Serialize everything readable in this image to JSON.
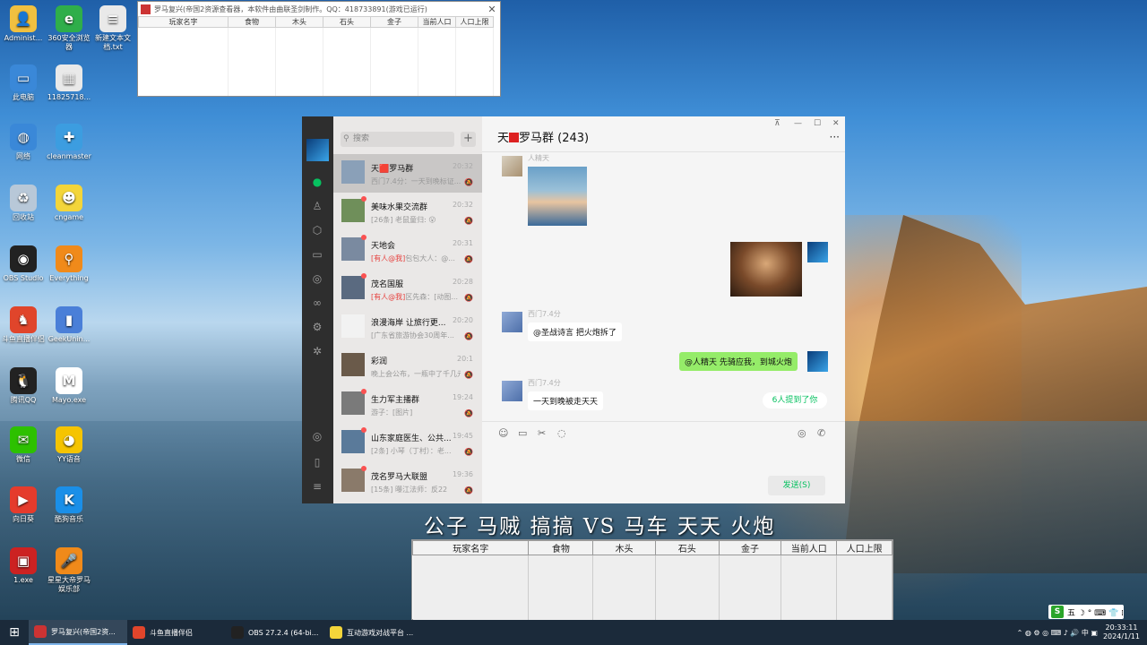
{
  "desktop_icons": [
    {
      "label": "Administ...",
      "color": "#f0c040",
      "glyph": "👤"
    },
    {
      "label": "360安全浏览器",
      "color": "#2fae4a",
      "glyph": "e"
    },
    {
      "label": "新建文本文档.txt",
      "color": "#e9e9e9",
      "glyph": "≡"
    },
    {
      "label": "此电脑",
      "color": "#3a88d8",
      "glyph": "▭"
    },
    {
      "label": "1182571​8...",
      "color": "#e9e9e9",
      "glyph": "▦"
    },
    {
      "label": "网络",
      "color": "#3a88d8",
      "glyph": "◍"
    },
    {
      "label": "cleanmaster",
      "color": "#3c9de0",
      "glyph": "✚"
    },
    {
      "label": "回收站",
      "color": "#b8c8d8",
      "glyph": "♻"
    },
    {
      "label": "cngame",
      "color": "#f3d53a",
      "glyph": "☻"
    },
    {
      "label": "OBS Studio",
      "color": "#222",
      "glyph": "◉"
    },
    {
      "label": "Everything",
      "color": "#f08a1a",
      "glyph": "⚲"
    },
    {
      "label": "斗鱼直播伴侣",
      "color": "#e0452b",
      "glyph": "♞"
    },
    {
      "label": "GeekUnin...",
      "color": "#4a7fd8",
      "glyph": "▮"
    },
    {
      "label": "腾讯QQ",
      "color": "#222",
      "glyph": "🐧"
    },
    {
      "label": "Mayo.exe",
      "color": "#fff",
      "glyph": "M"
    },
    {
      "label": "微信",
      "color": "#2dc100",
      "glyph": "✉"
    },
    {
      "label": "YY语音",
      "color": "#f5c400",
      "glyph": "◕"
    },
    {
      "label": "向日葵",
      "color": "#e53b2c",
      "glyph": "▶"
    },
    {
      "label": "酷狗音乐",
      "color": "#1a8fe8",
      "glyph": "K"
    },
    {
      "label": "1.exe",
      "color": "#c22",
      "glyph": "▣"
    },
    {
      "label": "星星大帝罗马娱乐部",
      "color": "#f08a1a",
      "glyph": "🎤"
    }
  ],
  "viewer": {
    "title": "罗马复兴(帝国2资源查看器，本软件由曲联圣剑制作。QQ：418733891(游戏已运行)",
    "close": "✕",
    "columns": [
      "玩家名字",
      "食物",
      "木头",
      "石头",
      "金子",
      "当前人口",
      "人口上限"
    ]
  },
  "wechat": {
    "search_placeholder": "搜索",
    "plus": "+",
    "chat_title_prefix": "天",
    "chat_title": "罗马群 (243)",
    "more": "···",
    "win_buttons": [
      "⊼",
      "—",
      "☐",
      "✕"
    ],
    "chats": [
      {
        "name": "天🟥罗马群",
        "time": "20:32",
        "preview": "西门7.4分：一天到晚标证...",
        "at": "",
        "color": "#8aa0b8",
        "dot": false
      },
      {
        "name": "美味水果交流群",
        "time": "20:32",
        "preview": "[26条] 老鼠童归: 😮",
        "at": "",
        "color": "#6f8f5a",
        "dot": true
      },
      {
        "name": "天地会",
        "time": "20:31",
        "preview": "包包大人：@...",
        "at": "[有人@我]",
        "color": "#7a8aa0",
        "dot": true
      },
      {
        "name": "茂名国服",
        "time": "20:28",
        "preview": "区先森：[动图...",
        "at": "[有人@我]",
        "color": "#5a6a80",
        "dot": true
      },
      {
        "name": "浪漫海岸 让旅行更...",
        "time": "20:20",
        "preview": "[广东省旅游协会30周年...",
        "at": "",
        "color": "#f2f2f2",
        "dot": false
      },
      {
        "name": "彩润",
        "time": "20:1",
        "preview": "晚上会公布，一瓶中了千几元",
        "at": "",
        "color": "#6a5a4a",
        "dot": false
      },
      {
        "name": "生力军主播群",
        "time": "19:24",
        "preview": "游子：[图片]",
        "at": "",
        "color": "#7a7a7a",
        "dot": true
      },
      {
        "name": "山东家庭医生、公共...",
        "time": "19:45",
        "preview": "[2条] 小琴（丁村）：老...",
        "at": "",
        "color": "#5a7a9a",
        "dot": true
      },
      {
        "name": "茂名罗马大联盟",
        "time": "19:36",
        "preview": "[15条] 曝江法师：反22",
        "at": "",
        "color": "#8a7a6a",
        "dot": true
      }
    ],
    "messages": {
      "m1_name": "人精天",
      "m3_name": "西门7.4分",
      "m3_text": "@圣战诗言 把火炮拆了",
      "m4_text": "@人精天 先骑应我，到城火炮",
      "m5_name": "西门7.4分",
      "m5_text": "一天到晚被走天天"
    },
    "at_tag": "6人提到了你",
    "send": "发送(S)"
  },
  "overlay_title": "公子 马贼 搞搞 VS 马车 天天 火炮",
  "stats_columns": [
    "玩家名字",
    "食物",
    "木头",
    "石头",
    "金子",
    "当前人口",
    "人口上限"
  ],
  "taskbar": {
    "start": "⊞",
    "tasks": [
      {
        "label": "罗马复兴(帝国2资...",
        "color": "#c33"
      },
      {
        "label": "斗鱼直播伴侣",
        "color": "#e0452b"
      },
      {
        "label": "OBS 27.2.4 (64-bi...",
        "color": "#222"
      },
      {
        "label": "互动游戏对战平台 ...",
        "color": "#f3d53a"
      }
    ],
    "tray_icons": "⌃ ◍ ⚙ ◎ ⌨ ♪ 🔊 中 ▣",
    "time": "20:33:11",
    "date": "2024/1/11"
  },
  "ime": {
    "logo": "S",
    "text": "五 ☽ ° ⌨ 👕 ⁞"
  }
}
